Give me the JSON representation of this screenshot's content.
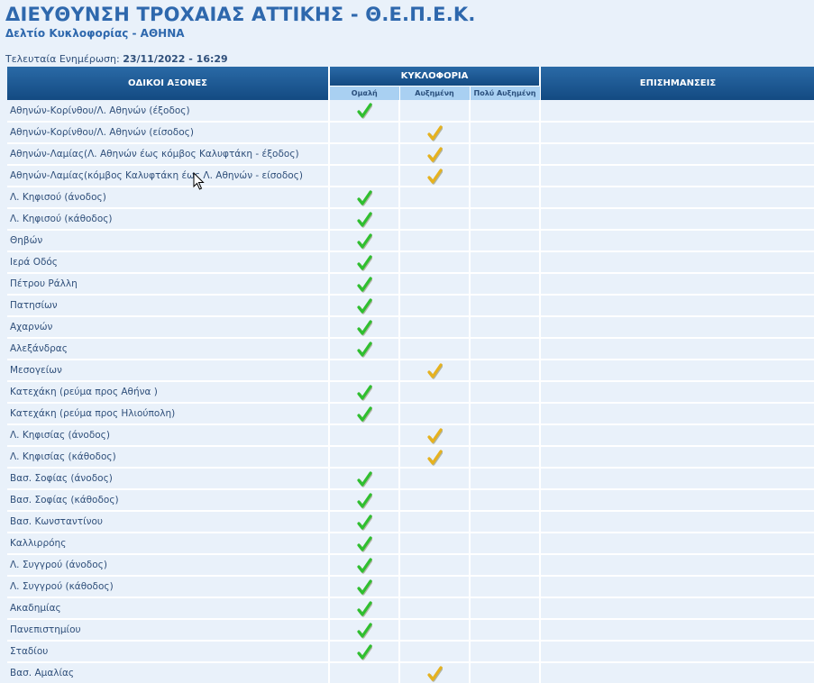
{
  "header": {
    "title": "ΔΙΕΥΘΥΝΣΗ ΤΡΟΧΑΙΑΣ ΑΤΤΙΚΗΣ - Θ.Ε.Π.Ε.Κ.",
    "subtitle": "Δελτίο Κυκλοφορίας - ΑΘΗΝΑ",
    "update_label": "Τελευταία Ενημέρωση:",
    "update_value": "23/11/2022 - 16:29"
  },
  "table": {
    "col_axes": "ΟΔΙΚΟΙ ΑΞΟΝΕΣ",
    "col_traffic": "ΚΥΚΛΟΦΟΡΙΑ",
    "col_notes": "ΕΠΙΣΗΜΑΝΣΕΙΣ",
    "status_labels": [
      "Ομαλή",
      "Αυξημένη",
      "Πολύ Αυξημένη"
    ],
    "status_icons": [
      "green-check-icon",
      "yellow-check-icon",
      ""
    ],
    "status_colors": [
      "#2fbf2f",
      "#e6b21e",
      "#d23a2a"
    ],
    "rows": [
      {
        "road": "Αθηνών-Κορίνθου/Λ. Αθηνών (έξοδος)",
        "status": 0,
        "notes": ""
      },
      {
        "road": "Αθηνών-Κορίνθου/Λ. Αθηνών (είσοδος)",
        "status": 1,
        "notes": ""
      },
      {
        "road": "Αθηνών-Λαμίας(Λ. Αθηνών έως κόμβος Καλυφτάκη - έξοδος)",
        "status": 1,
        "notes": ""
      },
      {
        "road": "Αθηνών-Λαμίας(κόμβος Καλυφτάκη έως Λ. Αθηνών - είσοδος)",
        "status": 1,
        "notes": ""
      },
      {
        "road": "Λ. Κηφισού (άνοδος)",
        "status": 0,
        "notes": ""
      },
      {
        "road": "Λ. Κηφισού (κάθοδος)",
        "status": 0,
        "notes": ""
      },
      {
        "road": "Θηβών",
        "status": 0,
        "notes": ""
      },
      {
        "road": "Ιερά Οδός",
        "status": 0,
        "notes": ""
      },
      {
        "road": "Πέτρου Ράλλη",
        "status": 0,
        "notes": ""
      },
      {
        "road": "Πατησίων",
        "status": 0,
        "notes": ""
      },
      {
        "road": "Αχαρνών",
        "status": 0,
        "notes": ""
      },
      {
        "road": "Αλεξάνδρας",
        "status": 0,
        "notes": ""
      },
      {
        "road": "Μεσογείων",
        "status": 1,
        "notes": ""
      },
      {
        "road": "Κατεχάκη (ρεύμα προς Αθήνα )",
        "status": 0,
        "notes": ""
      },
      {
        "road": "Κατεχάκη (ρεύμα προς Ηλιούπολη)",
        "status": 0,
        "notes": ""
      },
      {
        "road": "Λ. Κηφισίας (άνοδος)",
        "status": 1,
        "notes": ""
      },
      {
        "road": "Λ. Κηφισίας (κάθοδος)",
        "status": 1,
        "notes": ""
      },
      {
        "road": "Βασ. Σοφίας (άνοδος)",
        "status": 0,
        "notes": ""
      },
      {
        "road": "Βασ. Σοφίας (κάθοδος)",
        "status": 0,
        "notes": ""
      },
      {
        "road": "Βασ. Κωνσταντίνου",
        "status": 0,
        "notes": ""
      },
      {
        "road": "Καλλιρρόης",
        "status": 0,
        "notes": ""
      },
      {
        "road": "Λ. Συγγρού (άνοδος)",
        "status": 0,
        "notes": ""
      },
      {
        "road": "Λ. Συγγρού (κάθοδος)",
        "status": 0,
        "notes": ""
      },
      {
        "road": "Ακαδημίας",
        "status": 0,
        "notes": ""
      },
      {
        "road": "Πανεπιστημίου",
        "status": 0,
        "notes": ""
      },
      {
        "road": "Σταδίου",
        "status": 0,
        "notes": ""
      },
      {
        "road": "Βασ. Αμαλίας",
        "status": 1,
        "notes": ""
      }
    ]
  }
}
